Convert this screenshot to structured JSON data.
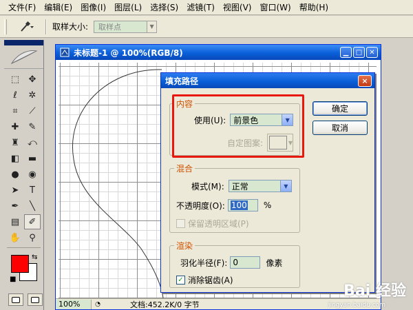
{
  "menubar": {
    "items": [
      "文件(F)",
      "编辑(E)",
      "图像(I)",
      "图层(L)",
      "选择(S)",
      "滤镜(T)",
      "视图(V)",
      "窗口(W)",
      "帮助(H)"
    ]
  },
  "options_bar": {
    "sample_size_label": "取样大小:",
    "sample_size_value": "取样点",
    "tool_icon": "eyedropper-icon"
  },
  "toolbox": {
    "foreground_color": "#ff0000",
    "background_color": "#ffffff"
  },
  "document": {
    "title": "未标题-1 @ 100%(RGB/8)",
    "zoom": "100%",
    "doc_info": "文档:452.2K/0 字节"
  },
  "dialog": {
    "title": "填充路径",
    "close_label": "×",
    "content_group": {
      "legend": "内容",
      "use_label": "使用(U):",
      "use_value": "前景色",
      "custom_pattern_label": "自定图案:"
    },
    "blend_group": {
      "legend": "混合",
      "mode_label": "模式(M):",
      "mode_value": "正常",
      "opacity_label": "不透明度(O):",
      "opacity_value": "100",
      "opacity_unit": "%",
      "preserve_transparency_label": "保留透明区域(P)",
      "preserve_transparency_checked": false
    },
    "render_group": {
      "legend": "渲染",
      "feather_label": "羽化半径(F):",
      "feather_value": "0",
      "feather_unit": "像素",
      "antialias_label": "消除锯齿(A)",
      "antialias_checked": true
    },
    "ok_label": "确定",
    "cancel_label": "取消"
  },
  "watermark": {
    "brand": "Bai 经验",
    "url": "jingyan.baidu.com"
  },
  "highlight_color": "#e8180f"
}
